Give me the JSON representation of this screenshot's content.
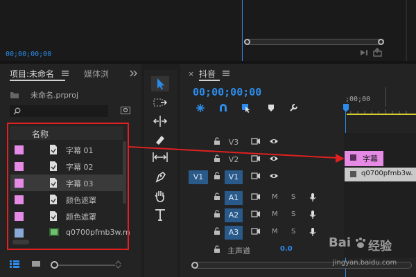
{
  "monitor": {
    "timecode": "00;00;00;00"
  },
  "project": {
    "tab_project": "项目:未命名",
    "tab_media": "媒体浏",
    "file_name": "未命名.prproj",
    "column_name": "名称",
    "items": [
      {
        "label": "字幕 01",
        "color": "#e58be6"
      },
      {
        "label": "字幕 02",
        "color": "#e58be6"
      },
      {
        "label": "字幕 03",
        "color": "#e58be6"
      },
      {
        "label": "颜色遮罩",
        "color": "#e58be6"
      },
      {
        "label": "颜色遮罩",
        "color": "#e58be6"
      },
      {
        "label": "q0700pfmb3w.m",
        "color": "#8aa9d6"
      }
    ]
  },
  "timeline": {
    "tab_title": "抖音",
    "timecode": "00;00;00;00",
    "ruler_start": ";00;00",
    "tracks": {
      "v3": "V3",
      "v2": "V2",
      "v1_src": "V1",
      "v1": "V1",
      "a1": "A1",
      "a2": "A2",
      "a3": "A3",
      "m": "M",
      "s": "S"
    },
    "master_label": "主声道",
    "master_value": "0.0",
    "clip_title": "字幕",
    "clip_video": "q0700pfmb3w."
  },
  "watermark": {
    "brand": "Bai",
    "brand_cn": "经验",
    "url": "jingyan.baidu.com"
  },
  "colors": {
    "accent": "#2d8ceb",
    "annotation": "#e02020",
    "clip_title": "#e58be6"
  }
}
